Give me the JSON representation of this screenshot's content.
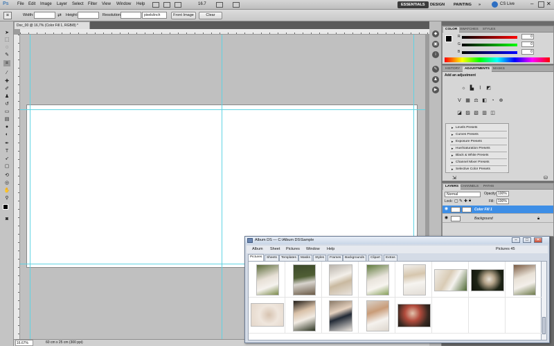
{
  "app": {
    "logo": "Ps",
    "menu": [
      "File",
      "Edit",
      "Image",
      "Layer",
      "Select",
      "Filter",
      "View",
      "Window",
      "Help"
    ],
    "zoom": "16.7",
    "workspaces": [
      "ESSENTIALS",
      "DESIGN",
      "PAINTING"
    ],
    "more": "»",
    "cs_live": "CS Live"
  },
  "options": {
    "width_label": "Width:",
    "height_label": "Height:",
    "resolution_label": "Resolution:",
    "units": "pixels/inch",
    "front_image": "Front Image",
    "clear": "Clear"
  },
  "document": {
    "tab_title": "Doc_00 @ 16,7% (Color Fill 1, RGB/8) *",
    "zoom_status": "16.67%",
    "size_status": "60 cm x 25 cm (300 ppi)"
  },
  "color_panel": {
    "tabs": [
      "COLOR",
      "SWATCHES",
      "STYLES"
    ],
    "channels": [
      {
        "label": "R",
        "value": "0",
        "color": "#d42a2a"
      },
      {
        "label": "G",
        "value": "0",
        "color": "#2cae2c"
      },
      {
        "label": "B",
        "value": "0",
        "color": "#2a49d4"
      }
    ]
  },
  "adjustments_panel": {
    "tabs": [
      "HISTORY",
      "ADJUSTMENTS",
      "MASKS"
    ],
    "heading": "Add an adjustment",
    "presets": [
      "Levels Presets",
      "Curves Presets",
      "Exposure Presets",
      "Hue/Saturation Presets",
      "Black & White Presets",
      "Channel Mixer Presets",
      "Selective Color Presets"
    ]
  },
  "layers_panel": {
    "tabs": [
      "LAYERS",
      "CHANNELS",
      "PATHS"
    ],
    "blend_mode": "Normal",
    "opacity_label": "Opacity:",
    "opacity": "100%",
    "lock_label": "Lock:",
    "fill_label": "Fill:",
    "fill": "100%",
    "layers": [
      {
        "name": "Color Fill 1",
        "selected": true
      },
      {
        "name": "Background",
        "selected": false
      }
    ]
  },
  "album_window": {
    "title": "Album DS  —  C:\\Album DS\\Sample",
    "menu": [
      "Album",
      "Sheet",
      "Pictures",
      "Window",
      "Help"
    ],
    "pictures_count": "Pictures 45",
    "tabs": [
      "Pictures",
      "Sheets",
      "Templates",
      "Masks",
      "Styles",
      "Frames",
      "Backgrounds",
      "Clipart",
      "Extras"
    ],
    "active_tab": "Pictures",
    "window_buttons": [
      "–",
      "□",
      "✕"
    ]
  },
  "colors": {
    "accent_selection": "#3d8ee6",
    "guide": "#5fd3e3"
  }
}
